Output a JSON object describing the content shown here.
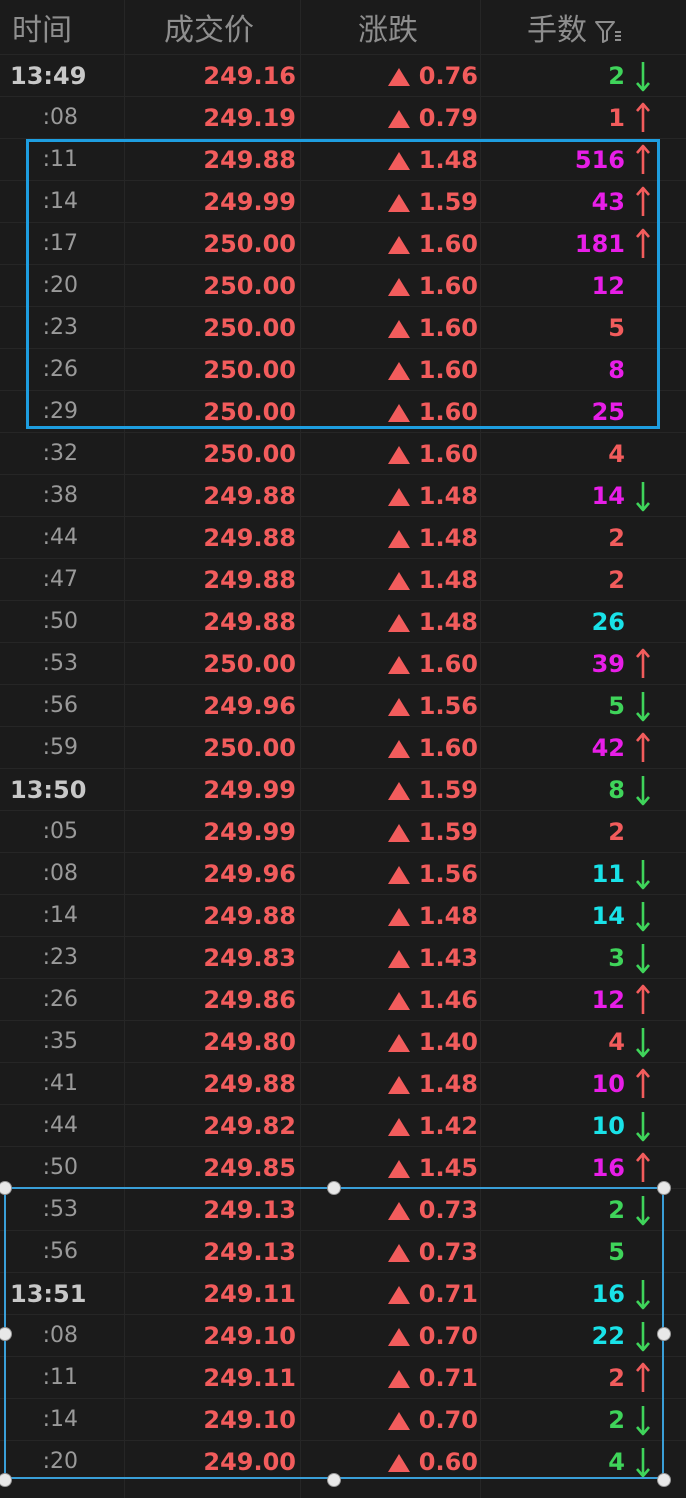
{
  "header": {
    "time_label": "时间",
    "price_label": "成交价",
    "change_label": "涨跌",
    "volume_label": "手数"
  },
  "colors": {
    "up": "#f25c5c",
    "down": "#3fd45a",
    "big": "#e81ee8",
    "mid": "#19e2e8",
    "small": "#f25c5c",
    "green_vol": "#3fd45a",
    "selection": "#1e9ee0"
  },
  "trades": [
    {
      "time": "13:49",
      "major": true,
      "price": "249.16",
      "change": "0.76",
      "volume": "2",
      "vol_color": "green",
      "arrow": "down"
    },
    {
      "time": ":08",
      "major": false,
      "price": "249.19",
      "change": "0.79",
      "volume": "1",
      "vol_color": "red",
      "arrow": "up"
    },
    {
      "time": ":11",
      "major": false,
      "price": "249.88",
      "change": "1.48",
      "volume": "516",
      "vol_color": "magenta",
      "arrow": "up"
    },
    {
      "time": ":14",
      "major": false,
      "price": "249.99",
      "change": "1.59",
      "volume": "43",
      "vol_color": "magenta",
      "arrow": "up"
    },
    {
      "time": ":17",
      "major": false,
      "price": "250.00",
      "change": "1.60",
      "volume": "181",
      "vol_color": "magenta",
      "arrow": "up"
    },
    {
      "time": ":20",
      "major": false,
      "price": "250.00",
      "change": "1.60",
      "volume": "12",
      "vol_color": "magenta",
      "arrow": ""
    },
    {
      "time": ":23",
      "major": false,
      "price": "250.00",
      "change": "1.60",
      "volume": "5",
      "vol_color": "red",
      "arrow": ""
    },
    {
      "time": ":26",
      "major": false,
      "price": "250.00",
      "change": "1.60",
      "volume": "8",
      "vol_color": "magenta",
      "arrow": ""
    },
    {
      "time": ":29",
      "major": false,
      "price": "250.00",
      "change": "1.60",
      "volume": "25",
      "vol_color": "magenta",
      "arrow": ""
    },
    {
      "time": ":32",
      "major": false,
      "price": "250.00",
      "change": "1.60",
      "volume": "4",
      "vol_color": "red",
      "arrow": ""
    },
    {
      "time": ":38",
      "major": false,
      "price": "249.88",
      "change": "1.48",
      "volume": "14",
      "vol_color": "magenta",
      "arrow": "down"
    },
    {
      "time": ":44",
      "major": false,
      "price": "249.88",
      "change": "1.48",
      "volume": "2",
      "vol_color": "red",
      "arrow": ""
    },
    {
      "time": ":47",
      "major": false,
      "price": "249.88",
      "change": "1.48",
      "volume": "2",
      "vol_color": "red",
      "arrow": ""
    },
    {
      "time": ":50",
      "major": false,
      "price": "249.88",
      "change": "1.48",
      "volume": "26",
      "vol_color": "cyan",
      "arrow": ""
    },
    {
      "time": ":53",
      "major": false,
      "price": "250.00",
      "change": "1.60",
      "volume": "39",
      "vol_color": "magenta",
      "arrow": "up"
    },
    {
      "time": ":56",
      "major": false,
      "price": "249.96",
      "change": "1.56",
      "volume": "5",
      "vol_color": "green",
      "arrow": "down"
    },
    {
      "time": ":59",
      "major": false,
      "price": "250.00",
      "change": "1.60",
      "volume": "42",
      "vol_color": "magenta",
      "arrow": "up"
    },
    {
      "time": "13:50",
      "major": true,
      "price": "249.99",
      "change": "1.59",
      "volume": "8",
      "vol_color": "green",
      "arrow": "down"
    },
    {
      "time": ":05",
      "major": false,
      "price": "249.99",
      "change": "1.59",
      "volume": "2",
      "vol_color": "red",
      "arrow": ""
    },
    {
      "time": ":08",
      "major": false,
      "price": "249.96",
      "change": "1.56",
      "volume": "11",
      "vol_color": "cyan",
      "arrow": "down"
    },
    {
      "time": ":14",
      "major": false,
      "price": "249.88",
      "change": "1.48",
      "volume": "14",
      "vol_color": "cyan",
      "arrow": "down"
    },
    {
      "time": ":23",
      "major": false,
      "price": "249.83",
      "change": "1.43",
      "volume": "3",
      "vol_color": "green",
      "arrow": "down"
    },
    {
      "time": ":26",
      "major": false,
      "price": "249.86",
      "change": "1.46",
      "volume": "12",
      "vol_color": "magenta",
      "arrow": "up"
    },
    {
      "time": ":35",
      "major": false,
      "price": "249.80",
      "change": "1.40",
      "volume": "4",
      "vol_color": "red",
      "arrow": "down"
    },
    {
      "time": ":41",
      "major": false,
      "price": "249.88",
      "change": "1.48",
      "volume": "10",
      "vol_color": "magenta",
      "arrow": "up"
    },
    {
      "time": ":44",
      "major": false,
      "price": "249.82",
      "change": "1.42",
      "volume": "10",
      "vol_color": "cyan",
      "arrow": "down"
    },
    {
      "time": ":50",
      "major": false,
      "price": "249.85",
      "change": "1.45",
      "volume": "16",
      "vol_color": "magenta",
      "arrow": "up"
    },
    {
      "time": ":53",
      "major": false,
      "price": "249.13",
      "change": "0.73",
      "volume": "2",
      "vol_color": "green",
      "arrow": "down"
    },
    {
      "time": ":56",
      "major": false,
      "price": "249.13",
      "change": "0.73",
      "volume": "5",
      "vol_color": "green",
      "arrow": ""
    },
    {
      "time": "13:51",
      "major": true,
      "price": "249.11",
      "change": "0.71",
      "volume": "16",
      "vol_color": "cyan",
      "arrow": "down"
    },
    {
      "time": ":08",
      "major": false,
      "price": "249.10",
      "change": "0.70",
      "volume": "22",
      "vol_color": "cyan",
      "arrow": "down"
    },
    {
      "time": ":11",
      "major": false,
      "price": "249.11",
      "change": "0.71",
      "volume": "2",
      "vol_color": "red",
      "arrow": "up"
    },
    {
      "time": ":14",
      "major": false,
      "price": "249.10",
      "change": "0.70",
      "volume": "2",
      "vol_color": "green",
      "arrow": "down"
    },
    {
      "time": ":20",
      "major": false,
      "price": "249.00",
      "change": "0.60",
      "volume": "4",
      "vol_color": "green",
      "arrow": "down"
    }
  ]
}
